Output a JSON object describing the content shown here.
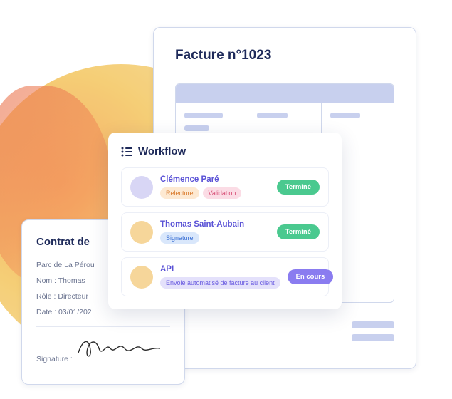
{
  "invoice": {
    "title": "Facture n°1023"
  },
  "contract": {
    "title": "Contrat de",
    "addr": "Parc de La Pérou",
    "name_label": "Nom :",
    "name_value": "Thomas",
    "role_label": "Rôle :",
    "role_value": "Directeur",
    "date_label": "Date :",
    "date_value": "03/01/202",
    "sig_label": "Signature :"
  },
  "workflow": {
    "title": "Workflow",
    "items": [
      {
        "name": "Clémence Paré",
        "tags": [
          "Relecture",
          "Validation"
        ],
        "tag_classes": [
          "orange",
          "pink"
        ],
        "status": "Terminé",
        "status_class": "done",
        "avatar": "av1"
      },
      {
        "name": "Thomas Saint-Aubain",
        "tags": [
          "Signature"
        ],
        "tag_classes": [
          "blue"
        ],
        "status": "Terminé",
        "status_class": "done",
        "avatar": "av2"
      },
      {
        "name": "API",
        "tags": [
          "Envoie automatisé de facture au client"
        ],
        "tag_classes": [
          "purple"
        ],
        "status": "En cours",
        "status_class": "progress",
        "avatar": "av3"
      }
    ]
  }
}
